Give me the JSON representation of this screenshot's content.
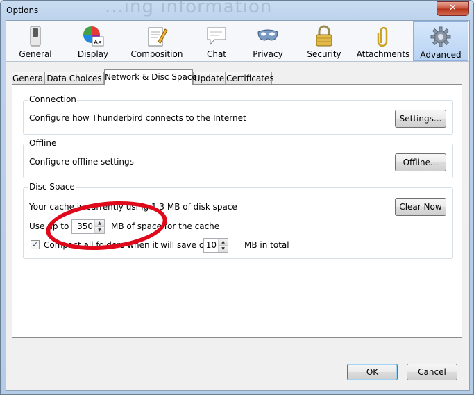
{
  "window": {
    "title": "Options",
    "ghost_text": "...ing information",
    "close_glyph": "✕"
  },
  "panes": [
    {
      "label": "General",
      "icon": "switch-icon"
    },
    {
      "label": "Display",
      "icon": "color-wheel-icon"
    },
    {
      "label": "Composition",
      "icon": "pencil-paper-icon"
    },
    {
      "label": "Chat",
      "icon": "speech-bubble-icon"
    },
    {
      "label": "Privacy",
      "icon": "mask-icon"
    },
    {
      "label": "Security",
      "icon": "padlock-icon"
    },
    {
      "label": "Attachments",
      "icon": "paperclip-icon"
    },
    {
      "label": "Advanced",
      "icon": "gear-icon",
      "selected": true
    }
  ],
  "tabs": [
    {
      "label": "General"
    },
    {
      "label": "Data Choices"
    },
    {
      "label": "Network & Disc Space",
      "active": true
    },
    {
      "label": "Update"
    },
    {
      "label": "Certificates"
    }
  ],
  "connection": {
    "caption": "Connection",
    "description": "Configure how Thunderbird connects to the Internet",
    "button": "Settings..."
  },
  "offline": {
    "caption": "Offline",
    "description": "Configure offline settings",
    "button": "Offline..."
  },
  "disc_space": {
    "caption": "Disc Space",
    "cache_status": "Your cache is currently using 1.3 MB of disk space",
    "clear_button": "Clear Now",
    "use_up_to_label": "Use up to",
    "cache_size_value": "350",
    "cache_size_suffix": "MB of space for the cache",
    "compact_checked": true,
    "compact_label": "Compact all folders when it will save over",
    "compact_value": "10",
    "compact_suffix": "MB in total"
  },
  "footer": {
    "ok": "OK",
    "cancel": "Cancel"
  },
  "colors": {
    "annotation": "#e0081b",
    "selected_pane": "#b8d3f3",
    "window_frame": "#bcd2ec"
  }
}
